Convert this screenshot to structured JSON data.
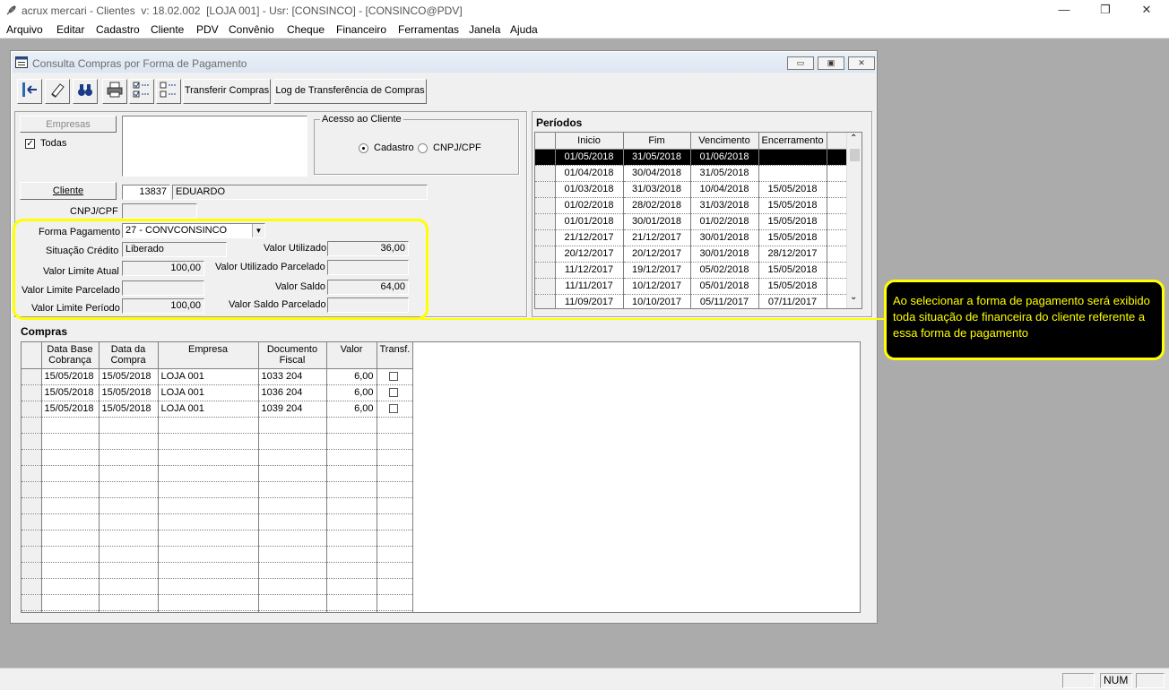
{
  "app_title": "acrux mercari - Clientes  v: 18.02.002  [LOJA 001] - Usr: [CONSINCO] - [CONSINCO@PDV]",
  "window_controls": {
    "minimize": "—",
    "restore": "❐",
    "close": "✕"
  },
  "menu": [
    "Arquivo",
    "Editar",
    "Cadastro",
    "Cliente",
    "PDV",
    "Convênio",
    "Cheque",
    "Financeiro",
    "Ferramentas",
    "Janela",
    "Ajuda"
  ],
  "child_window": {
    "title": "Consulta Compras por Forma de Pagamento"
  },
  "toolbar": {
    "transferir": "Transferir Compras",
    "log": "Log de Transferência de Compras"
  },
  "empresas": {
    "button": "Empresas",
    "todas_label": "Todas",
    "todas_checked": true
  },
  "acesso": {
    "legend": "Acesso ao Cliente",
    "cadastro": "Cadastro",
    "cnpj": "CNPJ/CPF",
    "selected": "Cadastro"
  },
  "cliente": {
    "button": "Cliente",
    "code": "13837",
    "name": "EDUARDO",
    "cnpj_label": "CNPJ/CPF",
    "cnpj_value": ""
  },
  "forma_pagamento": {
    "label": "Forma Pagamento",
    "value": "27 - CONVCONSINCO"
  },
  "situacao": {
    "label": "Situação Crédito",
    "value": "Liberado"
  },
  "valores": {
    "limite_atual_label": "Valor Limite Atual",
    "limite_atual": "100,00",
    "limite_parcelado_label": "Valor Limite Parcelado",
    "limite_parcelado": "",
    "limite_periodo_label": "Valor Limite Período",
    "limite_periodo": "100,00",
    "utilizado_label": "Valor Utilizado",
    "utilizado": "36,00",
    "utilizado_parcelado_label": "Valor Utilizado Parcelado",
    "utilizado_parcelado": "",
    "saldo_label": "Valor Saldo",
    "saldo": "64,00",
    "saldo_parcelado_label": "Valor Saldo Parcelado",
    "saldo_parcelado": ""
  },
  "periodos": {
    "title": "Períodos",
    "columns": [
      "Inicio",
      "Fim",
      "Vencimento",
      "Encerramento"
    ],
    "rows": [
      [
        "01/05/2018",
        "31/05/2018",
        "01/06/2018",
        ""
      ],
      [
        "01/04/2018",
        "30/04/2018",
        "31/05/2018",
        ""
      ],
      [
        "01/03/2018",
        "31/03/2018",
        "10/04/2018",
        "15/05/2018"
      ],
      [
        "01/02/2018",
        "28/02/2018",
        "31/03/2018",
        "15/05/2018"
      ],
      [
        "01/01/2018",
        "30/01/2018",
        "01/02/2018",
        "15/05/2018"
      ],
      [
        "21/12/2017",
        "21/12/2017",
        "30/01/2018",
        "15/05/2018"
      ],
      [
        "20/12/2017",
        "20/12/2017",
        "30/01/2018",
        "28/12/2017"
      ],
      [
        "11/12/2017",
        "19/12/2017",
        "05/02/2018",
        "15/05/2018"
      ],
      [
        "11/11/2017",
        "10/12/2017",
        "05/01/2018",
        "15/05/2018"
      ],
      [
        "11/09/2017",
        "10/10/2017",
        "05/11/2017",
        "07/11/2017"
      ]
    ]
  },
  "compras": {
    "title": "Compras",
    "columns": [
      "Data Base\nCobrança",
      "Data da\nCompra",
      "Empresa",
      "Documento\nFiscal",
      "Valor",
      "Transf."
    ],
    "rows": [
      [
        "15/05/2018",
        "15/05/2018",
        "LOJA 001",
        "1033 204",
        "6,00"
      ],
      [
        "15/05/2018",
        "15/05/2018",
        "LOJA 001",
        "1036 204",
        "6,00"
      ],
      [
        "15/05/2018",
        "15/05/2018",
        "LOJA 001",
        "1039 204",
        "6,00"
      ]
    ],
    "empty_rows": 14
  },
  "callout": "Ao selecionar a forma de pagamento será exibido toda situação de financeira do cliente referente a essa forma de pagamento",
  "status": {
    "num": "NUM"
  },
  "colors": {
    "highlight": "#ffff00",
    "mdi_bg": "#ababab",
    "selected_row": "#000000"
  }
}
